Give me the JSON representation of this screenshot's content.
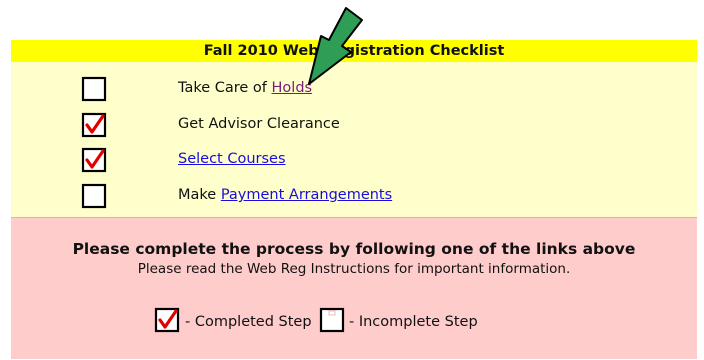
{
  "checklist": {
    "title": "Fall 2010 Web Registration Checklist",
    "items": [
      {
        "prefix": "Take Care of ",
        "link": "Holds",
        "suffix": "",
        "checked": false
      },
      {
        "prefix": "Get Advisor Clearance",
        "link": "",
        "suffix": "",
        "checked": true
      },
      {
        "prefix": "",
        "link": "Select Courses",
        "suffix": "",
        "checked": true
      },
      {
        "prefix": "Make ",
        "link": "Payment Arrangements",
        "suffix": "",
        "checked": false
      }
    ]
  },
  "footer": {
    "message": "Please complete the process by following one of the links above",
    "instructions": "Please read the Web Reg Instructions for important information.",
    "legend_completed": "- Completed Step",
    "legend_incomplete": "- Incomplete Step"
  },
  "colors": {
    "header_bg": "#ffff00",
    "panel_bg": "#ffffcc",
    "footer_bg": "#ffcccc",
    "check_red": "#e00000",
    "link_blue": "#1a0dde",
    "link_visited": "#7a1a7a",
    "arrow_green": "#2e9e57"
  }
}
